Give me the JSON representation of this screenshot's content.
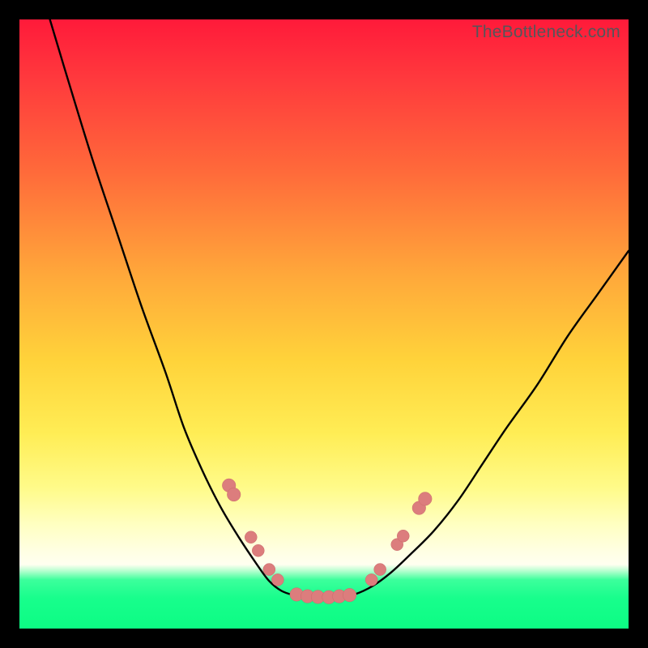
{
  "watermark": "TheBottleneck.com",
  "colors": {
    "frame": "#000000",
    "gradient_top": "#ff1a3a",
    "gradient_mid": "#ffd33a",
    "gradient_band": "#ffffe4",
    "gradient_bottom": "#18fe8c",
    "curve": "#000000",
    "marker_fill": "#dc7d7d",
    "marker_stroke": "#c96a6a"
  },
  "chart_data": {
    "type": "line",
    "title": "",
    "xlabel": "",
    "ylabel": "",
    "xlim": [
      0,
      100
    ],
    "ylim": [
      0,
      100
    ],
    "series": [
      {
        "name": "left-curve",
        "x": [
          5,
          8,
          12,
          16,
          20,
          24,
          27,
          30,
          33,
          36,
          39,
          41,
          43,
          45
        ],
        "y": [
          100,
          90,
          77,
          65,
          53,
          42,
          33,
          26,
          20,
          15,
          10.5,
          7.8,
          6.2,
          5.5
        ]
      },
      {
        "name": "trough",
        "x": [
          45,
          47,
          49,
          51,
          53,
          55
        ],
        "y": [
          5.5,
          5.2,
          5.1,
          5.1,
          5.3,
          5.6
        ]
      },
      {
        "name": "right-curve",
        "x": [
          55,
          58,
          61,
          64,
          68,
          72,
          76,
          80,
          85,
          90,
          95,
          100
        ],
        "y": [
          5.6,
          7.0,
          9.2,
          12,
          16,
          21,
          27,
          33,
          40,
          48,
          55,
          62
        ]
      }
    ],
    "markers": {
      "name": "highlighted-points",
      "points": [
        {
          "x": 34.4,
          "y": 23.5,
          "r": 1.1
        },
        {
          "x": 35.2,
          "y": 22.0,
          "r": 1.1
        },
        {
          "x": 38.0,
          "y": 15.0,
          "r": 1.0
        },
        {
          "x": 39.2,
          "y": 12.8,
          "r": 1.0
        },
        {
          "x": 41.0,
          "y": 9.7,
          "r": 1.0
        },
        {
          "x": 42.4,
          "y": 8.0,
          "r": 1.0
        },
        {
          "x": 45.5,
          "y": 5.6,
          "r": 1.1
        },
        {
          "x": 47.3,
          "y": 5.3,
          "r": 1.1
        },
        {
          "x": 49.0,
          "y": 5.2,
          "r": 1.1
        },
        {
          "x": 50.8,
          "y": 5.15,
          "r": 1.1
        },
        {
          "x": 52.5,
          "y": 5.3,
          "r": 1.1
        },
        {
          "x": 54.2,
          "y": 5.5,
          "r": 1.1
        },
        {
          "x": 57.8,
          "y": 8.0,
          "r": 1.0
        },
        {
          "x": 59.2,
          "y": 9.7,
          "r": 1.0
        },
        {
          "x": 62.0,
          "y": 13.8,
          "r": 1.0
        },
        {
          "x": 63.0,
          "y": 15.2,
          "r": 1.0
        },
        {
          "x": 65.6,
          "y": 19.8,
          "r": 1.1
        },
        {
          "x": 66.6,
          "y": 21.3,
          "r": 1.1
        }
      ]
    }
  }
}
